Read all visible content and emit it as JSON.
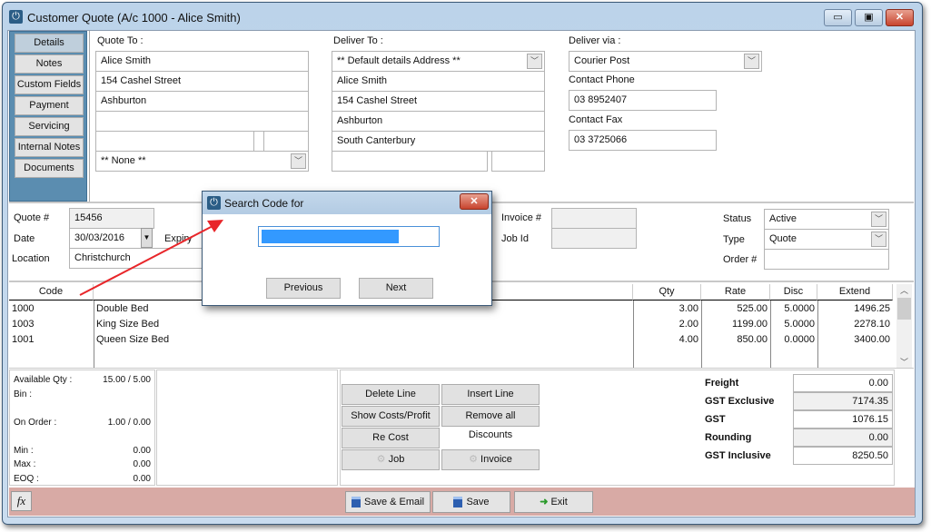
{
  "window": {
    "title": "Customer Quote (A/c 1000 - Alice Smith)",
    "min": "▭",
    "max": "▣",
    "close": "✕"
  },
  "sidebar": {
    "items": [
      {
        "label": "Details",
        "selected": true
      },
      {
        "label": "Notes"
      },
      {
        "label": "Custom Fields"
      },
      {
        "label": "Payment"
      },
      {
        "label": "Servicing"
      },
      {
        "label": "Internal Notes"
      },
      {
        "label": "Documents"
      }
    ]
  },
  "quote_to": {
    "label": "Quote To :",
    "lines": [
      "Alice Smith",
      "154 Cashel Street",
      "Ashburton",
      ""
    ],
    "combo": "** None **"
  },
  "deliver_to": {
    "label": "Deliver To :",
    "combo": "** Default details Address **",
    "lines": [
      "Alice Smith",
      "154 Cashel Street",
      "Ashburton",
      "South Canterbury"
    ]
  },
  "deliver_via": {
    "label": "Deliver via :",
    "value": "Courier Post",
    "phone_label": "Contact Phone",
    "phone": "03 8952407",
    "fax_label": "Contact Fax",
    "fax": "03 3725066"
  },
  "header": {
    "quote_label": "Quote #",
    "quote": "15456",
    "date_label": "Date",
    "date": "30/03/2016",
    "expiry_label": "Expiry",
    "location_label": "Location",
    "location": "Christchurch",
    "invoice_label": "Invoice #",
    "invoice": "",
    "jobid_label": "Job Id",
    "jobid": "",
    "status_label": "Status",
    "status": "Active",
    "type_label": "Type",
    "type": "Quote",
    "order_label": "Order #",
    "order": ""
  },
  "grid": {
    "columns": [
      "Code",
      "",
      "Qty",
      "Rate",
      "Disc",
      "Extend"
    ],
    "rows": [
      {
        "code": "1000",
        "desc": "Double Bed",
        "qty": "3.00",
        "rate": "525.00",
        "disc": "5.0000",
        "extend": "1496.25"
      },
      {
        "code": "1003",
        "desc": "King Size Bed",
        "qty": "2.00",
        "rate": "1199.00",
        "disc": "5.0000",
        "extend": "2278.10"
      },
      {
        "code": "1001",
        "desc": "Queen Size Bed",
        "qty": "4.00",
        "rate": "850.00",
        "disc": "0.0000",
        "extend": "3400.00"
      }
    ]
  },
  "stock": {
    "avail_label": "Available Qty :",
    "avail": "15.00 / 5.00",
    "bin_label": "Bin :",
    "onorder_label": "On Order :",
    "onorder": "1.00 / 0.00",
    "min_label": "Min :",
    "min": "0.00",
    "max_label": "Max :",
    "max": "0.00",
    "eoq_label": "EOQ :",
    "eoq": "0.00"
  },
  "actions": {
    "delete": "Delete Line",
    "insert": "Insert Line",
    "costs": "Show Costs/Profit",
    "remove": "Remove all Discounts",
    "recost": "Re Cost",
    "job": "Job",
    "invoice": "Invoice"
  },
  "totals": [
    {
      "label": "Freight",
      "value": "0.00"
    },
    {
      "label": "GST Exclusive",
      "value": "7174.35"
    },
    {
      "label": "GST",
      "value": "1076.15"
    },
    {
      "label": "Rounding",
      "value": "0.00"
    },
    {
      "label": "GST Inclusive",
      "value": "8250.50"
    }
  ],
  "footer": {
    "fx": "fx",
    "save_email": "Save & Email",
    "save": "Save",
    "exit": "Exit"
  },
  "dialog": {
    "title": "Search Code for",
    "close": "✕",
    "previous": "Previous",
    "next": "Next",
    "selection_color": "#3399ff"
  },
  "annotation": {
    "arrow_color": "#e8262a"
  }
}
